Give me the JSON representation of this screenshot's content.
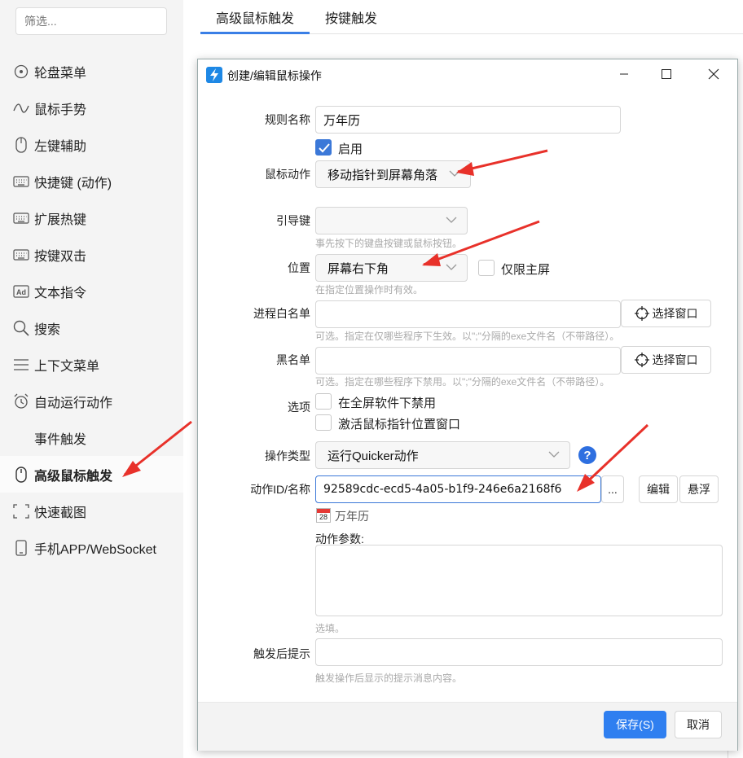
{
  "sidebar": {
    "filter_placeholder": "筛选...",
    "items": [
      {
        "label": "轮盘菜单",
        "icon": "wheel-icon"
      },
      {
        "label": "鼠标手势",
        "icon": "gesture-icon"
      },
      {
        "label": "左键辅助",
        "icon": "mouse-icon"
      },
      {
        "label": "快捷键 (动作)",
        "icon": "keyboard-icon"
      },
      {
        "label": "扩展热键",
        "icon": "keyboard-icon"
      },
      {
        "label": "按键双击",
        "icon": "keyboard-icon"
      },
      {
        "label": "文本指令",
        "icon": "ad-icon"
      },
      {
        "label": "搜索",
        "icon": "search-icon"
      },
      {
        "label": "上下文菜单",
        "icon": "menu-icon"
      },
      {
        "label": "自动运行动作",
        "icon": "alarm-icon"
      },
      {
        "label": "事件触发",
        "icon": "event-icon"
      },
      {
        "label": "高级鼠标触发",
        "icon": "mouse-icon"
      },
      {
        "label": "快速截图",
        "icon": "screenshot-icon"
      },
      {
        "label": "手机APP/WebSocket",
        "icon": "phone-icon"
      }
    ],
    "active_index": 11
  },
  "tabs": [
    {
      "label": "高级鼠标触发",
      "active": true
    },
    {
      "label": "按键触发",
      "active": false
    }
  ],
  "dialog": {
    "title": "创建/编辑鼠标操作",
    "fields": {
      "rule_name": {
        "label": "规则名称",
        "value": "万年历"
      },
      "enabled": {
        "label": "启用",
        "checked": true
      },
      "mouse_action": {
        "label": "鼠标动作",
        "value": "移动指针到屏幕角落"
      },
      "guide_key": {
        "label": "引导键",
        "value": "",
        "hint": "事先按下的键盘按键或鼠标按钮。"
      },
      "position": {
        "label": "位置",
        "value": "屏幕右下角",
        "hint": "在指定位置操作时有效。"
      },
      "primary_only": {
        "label": "仅限主屏",
        "checked": false
      },
      "whitelist": {
        "label": "进程白名单",
        "value": "",
        "hint": "可选。指定在仅哪些程序下生效。以\";\"分隔的exe文件名（不带路径）。",
        "button": "选择窗口"
      },
      "blacklist": {
        "label": "黑名单",
        "value": "",
        "hint": "可选。指定在哪些程序下禁用。以\";\"分隔的exe文件名（不带路径）。",
        "button": "选择窗口"
      },
      "options": {
        "label": "选项",
        "items": [
          {
            "label": "在全屏软件下禁用",
            "checked": false
          },
          {
            "label": "激活鼠标指针位置窗口",
            "checked": false
          }
        ]
      },
      "op_type": {
        "label": "操作类型",
        "value": "运行Quicker动作"
      },
      "action_id": {
        "label": "动作ID/名称",
        "value": "92589cdc-ecd5-4a05-b1f9-246e6a2168f6",
        "more": "...",
        "edit": "编辑",
        "float": "悬浮"
      },
      "action_name": {
        "value": "万年历",
        "calendar_day": "28"
      },
      "action_params": {
        "label": "动作参数:",
        "hint": "选填。"
      },
      "after_tip": {
        "label": "触发后提示",
        "value": "",
        "hint": "触发操作后显示的提示消息内容。"
      }
    },
    "save": "保存(S)",
    "cancel": "取消"
  },
  "colors": {
    "accent": "#2f7ff0",
    "arrow": "#e8312a",
    "help": "#2e6fe0"
  }
}
